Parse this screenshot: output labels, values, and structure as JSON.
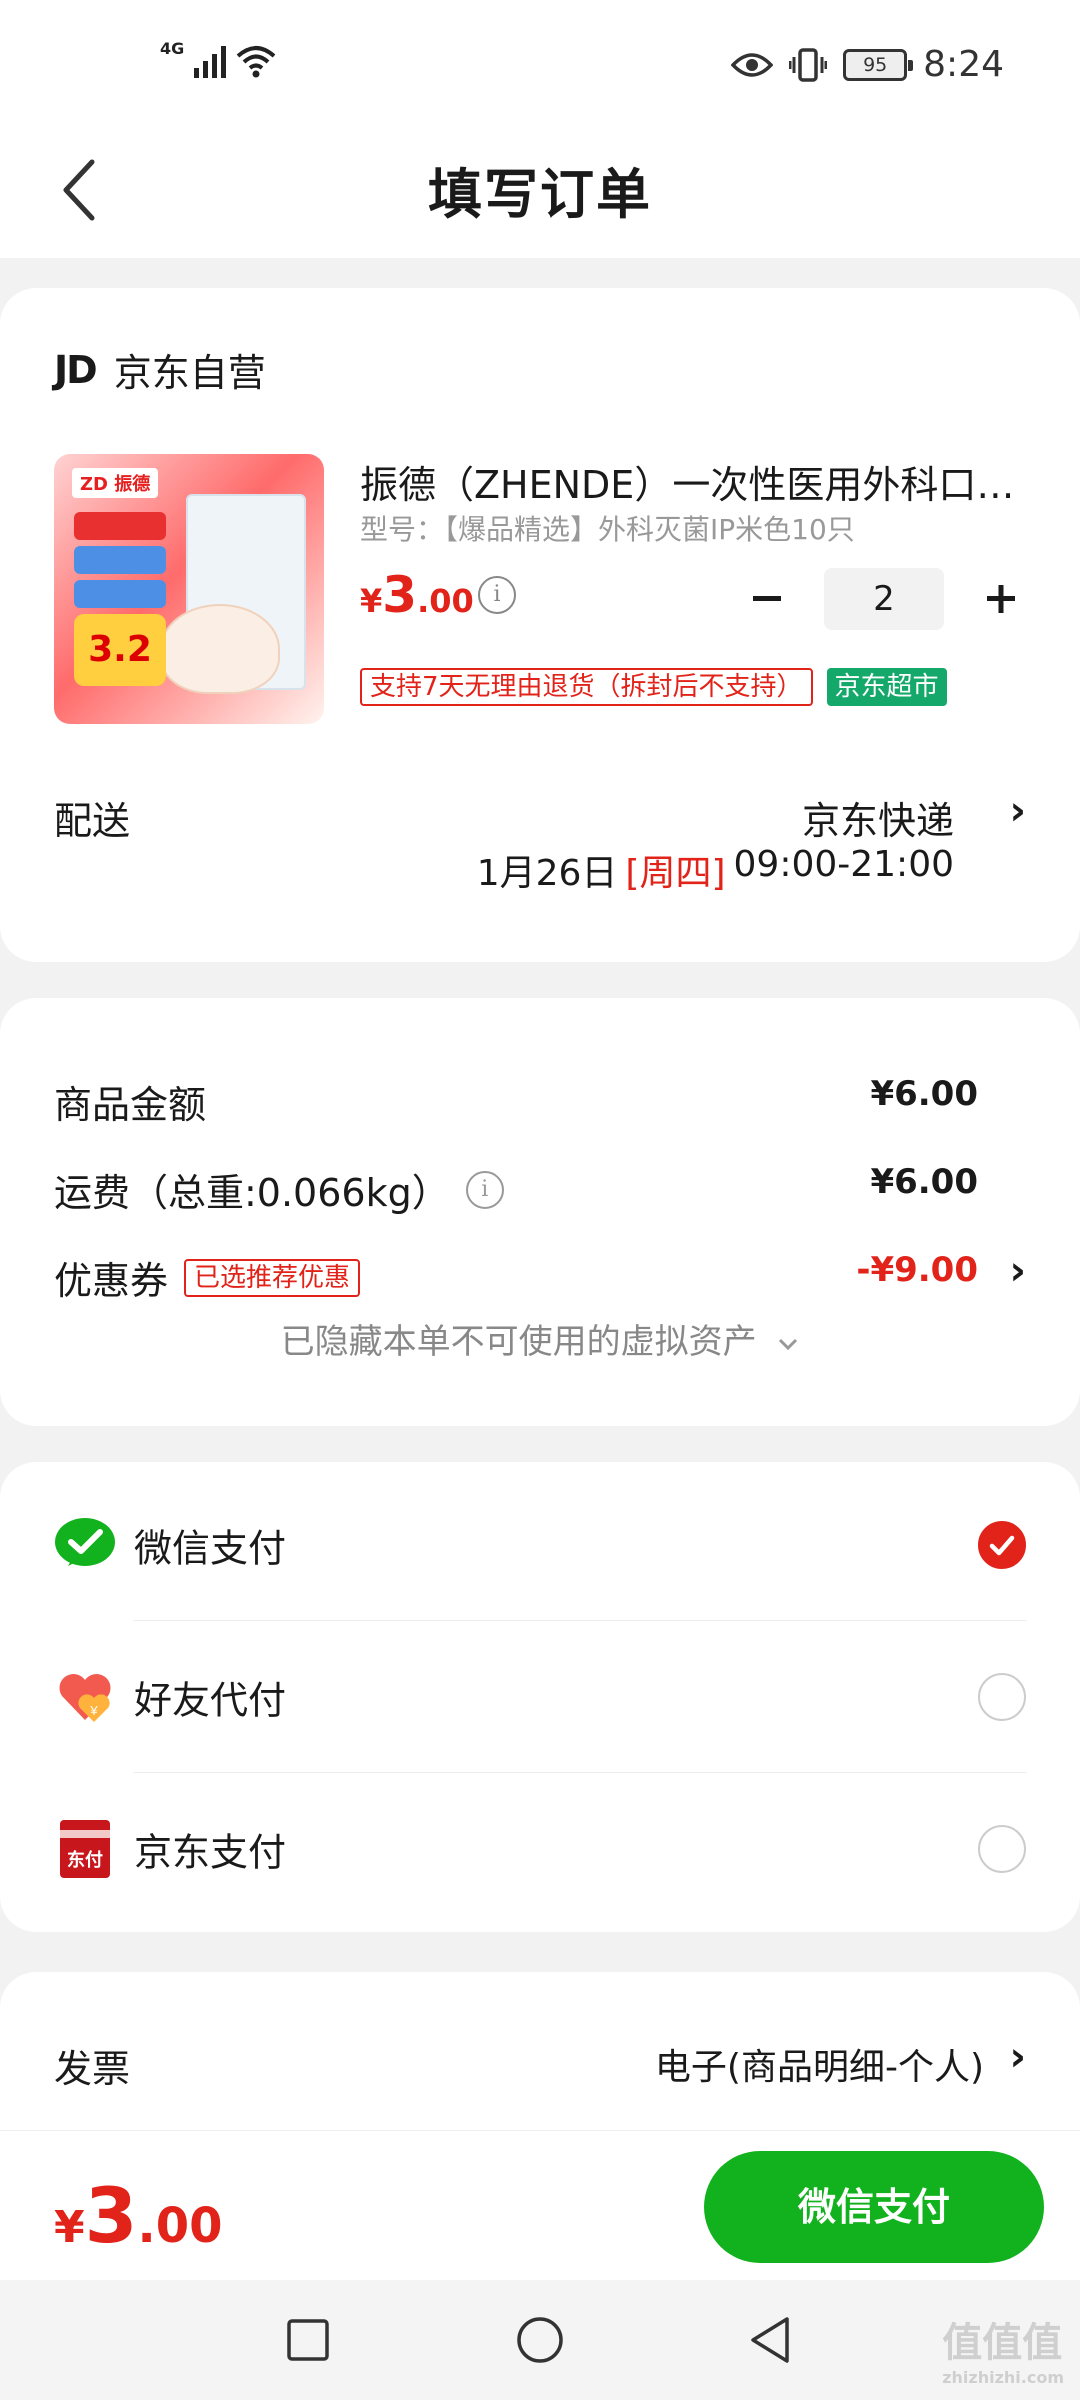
{
  "status_bar": {
    "network": "4G",
    "battery": "95",
    "time": "8:24"
  },
  "header": {
    "title": "填写订单"
  },
  "shop": {
    "logo": "JD",
    "name": "京东自营"
  },
  "product": {
    "image_brand": "ZD 振德",
    "image_price": "3.2",
    "title": "振德（ZHENDE）一次性医用外科口…",
    "spec": "型号：【爆品精选】外科灭菌IP米色10只",
    "price_symbol": "¥",
    "price_int": "3",
    "price_dec": ".00",
    "quantity": "2",
    "return_tag": "支持7天无理由退货（拆封后不支持）",
    "market_tag": "京东超市"
  },
  "delivery": {
    "label": "配送",
    "method": "京东快递",
    "date": "1月26日",
    "weekday": "[周四]",
    "time": "09:00-21:00"
  },
  "summary": {
    "goods_label": "商品金额",
    "goods_value": "¥6.00",
    "shipping_label": "运费（总重:0.066kg）",
    "shipping_value": "¥6.00",
    "coupon_label": "优惠券",
    "coupon_badge": "已选推荐优惠",
    "coupon_value": "-¥9.00",
    "hidden_assets": "已隐藏本单不可使用的虚拟资产"
  },
  "payment": {
    "options": [
      {
        "label": "微信支付",
        "selected": true,
        "icon": "wechat-pay-icon"
      },
      {
        "label": "好友代付",
        "selected": false,
        "icon": "friend-pay-icon"
      },
      {
        "label": "京东支付",
        "selected": false,
        "icon": "jd-pay-icon"
      }
    ],
    "jd_icon_text": "东付"
  },
  "invoice": {
    "label": "发票",
    "value": "电子(商品明细-个人)"
  },
  "bottom": {
    "total_symbol": "¥",
    "total_int": "3",
    "total_dec": ".00",
    "pay_button": "微信支付"
  },
  "watermark": {
    "text": "值值值",
    "sub": "zhizhizhi.com"
  },
  "colors": {
    "accent_red": "#e2231a",
    "wechat_green": "#12b21e",
    "market_green": "#14a86a"
  }
}
